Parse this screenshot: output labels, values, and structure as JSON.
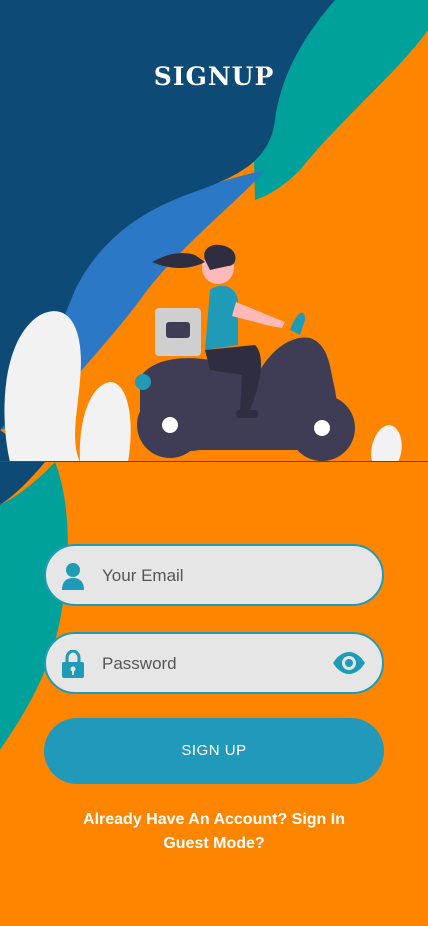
{
  "header": {
    "title": "SIGNUP"
  },
  "form": {
    "email": {
      "placeholder": "Your Email",
      "value": ""
    },
    "password": {
      "placeholder": "Password",
      "value": ""
    },
    "submit_label": "SIGN UP"
  },
  "links": {
    "sign_in": "Already Have An Account? Sign In",
    "guest": "Guest Mode?"
  },
  "icons": {
    "email_field": "user-icon",
    "password_field": "lock-icon",
    "password_toggle": "eye-icon"
  },
  "colors": {
    "background_orange": "#fd8500",
    "navy": "#0d4a75",
    "teal": "#00a19a",
    "blue": "#2a78c6",
    "accent": "#2199ba",
    "field_bg": "#e6e6e6"
  }
}
